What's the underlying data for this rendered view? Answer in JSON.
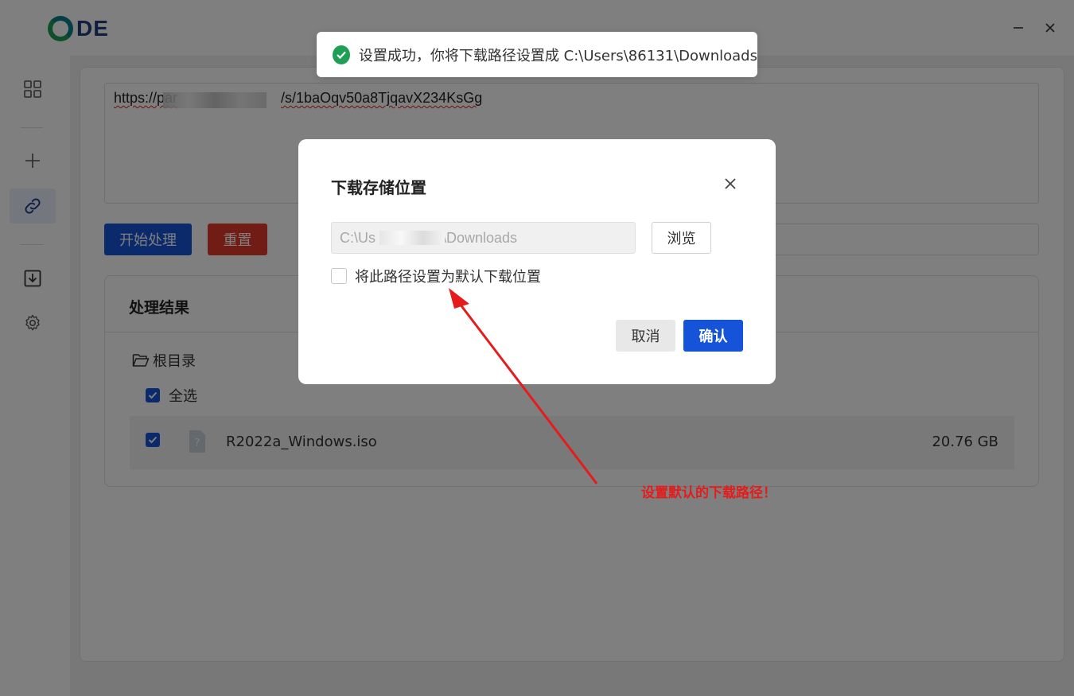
{
  "app": {
    "logo_text": "DE"
  },
  "window": {
    "minimize": "—",
    "close": "✕"
  },
  "sidebar": {
    "items": [
      {
        "icon": "grid-icon"
      },
      {
        "icon": "plus-icon"
      },
      {
        "icon": "link-icon",
        "active": true
      },
      {
        "icon": "download-icon"
      },
      {
        "icon": "gear-icon"
      }
    ]
  },
  "main": {
    "url_value_start": "https://par",
    "url_value_end": "/s/1baOqv50a8TjqavX234KsGg",
    "start_button": "开始处理",
    "reset_button": "重置",
    "results": {
      "title": "处理结果",
      "root_label": "根目录",
      "select_all_label": "全选",
      "files": [
        {
          "name": "R2022a_Windows.iso",
          "size": "20.76 GB",
          "checked": true
        }
      ]
    }
  },
  "toast": {
    "message": "设置成功，你将下载路径设置成 C:\\Users\\86131\\Downloads"
  },
  "dialog": {
    "title": "下载存储位置",
    "path_prefix": "C:\\Us",
    "path_suffix": "\\Downloads",
    "browse_button": "浏览",
    "default_checkbox_label": "将此路径设置为默认下载位置",
    "default_checked": false,
    "cancel_button": "取消",
    "confirm_button": "确认"
  },
  "annotation": {
    "text": "设置默认的下载路径！",
    "color": "#e41c1c"
  },
  "colors": {
    "primary": "#1554d9",
    "danger": "#e23a2c",
    "success": "#1f9e55"
  }
}
